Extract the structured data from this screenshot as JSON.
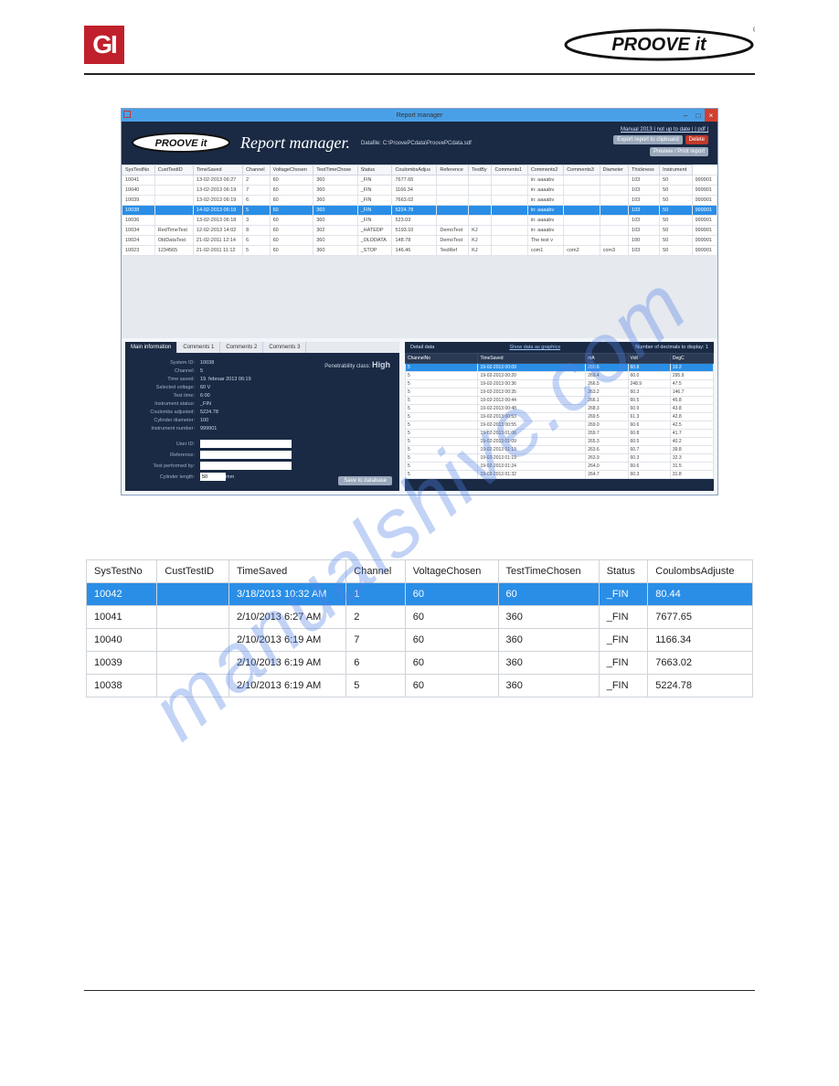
{
  "header": {
    "gi_logo_text": "GI",
    "proove_logo_text": "PROOVE it"
  },
  "watermark": "manualshive.com",
  "app": {
    "title_bar": "Report manager",
    "toolbar_title": "Report manager.",
    "datafile_label": "Datafile:",
    "datafile_path": "C:\\ProovePCdata\\ProovePCdata.sdf",
    "top_link": "Manual 2013 | not up to date | | pdf |",
    "btn_export": "Export report to clipboard",
    "btn_delete": "Delete",
    "btn_preview": "Preview / Print report",
    "main_columns": [
      "SysTestNo",
      "CustTestID",
      "TimeSaved",
      "Channel",
      "VoltageChosen",
      "TestTimeChose",
      "Status",
      "CoulombsAdjus",
      "Reference",
      "TestBy",
      "Comments1",
      "Comments2",
      "Comments3",
      "Diameter",
      "Thickness",
      "Instrument"
    ],
    "main_rows": [
      {
        "cells": [
          "10041",
          "",
          "13-02-2013 06:27",
          "2",
          "60",
          "360",
          "_FIN",
          "7677.65",
          "",
          "",
          "",
          "in: aaaabv",
          "",
          "",
          "103",
          "50",
          "999901"
        ],
        "sel": false
      },
      {
        "cells": [
          "10040",
          "",
          "13-02-2013 06:19",
          "7",
          "60",
          "360",
          "_FIN",
          "1166.34",
          "",
          "",
          "",
          "in: aaaabv",
          "",
          "",
          "103",
          "50",
          "999901"
        ],
        "sel": false
      },
      {
        "cells": [
          "10039",
          "",
          "13-02-2013 06:19",
          "6",
          "60",
          "360",
          "_FIN",
          "7663.02",
          "",
          "",
          "",
          "in: aaaabv",
          "",
          "",
          "103",
          "50",
          "999901"
        ],
        "sel": false
      },
      {
        "cells": [
          "10038",
          "",
          "14-02-2013 06:19",
          "5",
          "60",
          "360",
          "_FIN",
          "5224.78",
          "",
          "",
          "",
          "in: aaaabv",
          "",
          "",
          "103",
          "50",
          "999901"
        ],
        "sel": true
      },
      {
        "cells": [
          "10036",
          "",
          "13-02-2013 06:18",
          "3",
          "60",
          "360",
          "_FIN",
          "523.03",
          "",
          "",
          "",
          "in: aaaabv",
          "",
          "",
          "103",
          "50",
          "999901"
        ],
        "sel": false
      },
      {
        "cells": [
          "10034",
          "RedTimeTest",
          "12-02-2013 14:02",
          "8",
          "60",
          "302",
          "_HATEDP",
          "5193.10",
          "DemoTest",
          "KJ",
          "",
          "in: aaaabv",
          "",
          "",
          "103",
          "50",
          "999901"
        ],
        "sel": false
      },
      {
        "cells": [
          "10024",
          "OldDataTest",
          "21-02-2011 12:14",
          "6",
          "60",
          "360",
          "_OLDDATA",
          "148.78",
          "DemoTest",
          "KJ",
          "",
          "The test v",
          "",
          "",
          "100",
          "50",
          "999901"
        ],
        "sel": false
      },
      {
        "cells": [
          "10023",
          "1234565",
          "21-02-2011 11:12",
          "5",
          "60",
          "360",
          "_STOP",
          "146.46",
          "TestRef",
          "KJ",
          "",
          "com1",
          "com2",
          "com3",
          "103",
          "50",
          "999901"
        ],
        "sel": false
      }
    ],
    "tabs": [
      "Main information",
      "Comments 1",
      "Comments 2",
      "Comments 3"
    ],
    "form": {
      "system_id_label": "System ID:",
      "system_id": "10038",
      "channel_label": "Channel:",
      "channel": "5",
      "time_saved_label": "Time saved:",
      "time_saved": "19. februar 2013 06:19",
      "selected_voltage_label": "Selected voltage:",
      "selected_voltage": "60 V",
      "test_time_label": "Test time:",
      "test_time": "6:00",
      "instrument_status_label": "Instrument status:",
      "instrument_status": "_FIN",
      "coulombs_adjusted_label": "Coulombs adjusted:",
      "coulombs_adjusted": "5224.78",
      "cylinder_diameter_label": "Cylinder diameter:",
      "cylinder_diameter": "100",
      "instrument_number_label": "Instrument number:",
      "instrument_number": "999901",
      "user_id_label": "User ID:",
      "user_id": "",
      "reference_label": "Reference:",
      "reference": "",
      "test_performed_by_label": "Test performed by:",
      "test_performed_by": "",
      "cylinder_length_label": "Cylinder length:",
      "cylinder_length": "50",
      "cylinder_length_unit": "mm"
    },
    "pen_label": "Penetrability class:",
    "pen_value": "High",
    "save_btn": "Save to database",
    "detail_head_left": "Detail data",
    "detail_head_link": "Show data as graphics",
    "detail_head_right": "Number of decimals to display:",
    "detail_decimals": "1",
    "detail_columns": [
      "ChannelNo",
      "TimeSaved",
      "mA",
      "Volt",
      "DegC"
    ],
    "detail_rows": [
      {
        "cells": [
          "5",
          "19-02-2013 00:09",
          "280.6",
          "60.8",
          "19.2"
        ],
        "sel": true
      },
      {
        "cells": [
          "5",
          "19-02-2013 00:20",
          "269.4",
          "60.0",
          "295.9"
        ],
        "sel": false
      },
      {
        "cells": [
          "5",
          "19-02-2013 00:36",
          "266.5",
          "248.9",
          "47.5"
        ],
        "sel": false
      },
      {
        "cells": [
          "5",
          "19-02-2013 00:35",
          "263.2",
          "60.3",
          "146.7"
        ],
        "sel": false
      },
      {
        "cells": [
          "5",
          "19-02-2013 00:44",
          "266.1",
          "60.5",
          "45.8"
        ],
        "sel": false
      },
      {
        "cells": [
          "5",
          "19-02-2013 00:48",
          "268.3",
          "60.9",
          "43.8"
        ],
        "sel": false
      },
      {
        "cells": [
          "5",
          "19-02-2013 00:53",
          "269.5",
          "61.3",
          "42.8"
        ],
        "sel": false
      },
      {
        "cells": [
          "5",
          "19-02-2013 00:55",
          "269.0",
          "60.6",
          "42.5"
        ],
        "sel": false
      },
      {
        "cells": [
          "5",
          "19-02-2013 01:06",
          "269.7",
          "60.8",
          "41.7"
        ],
        "sel": false
      },
      {
        "cells": [
          "5",
          "19-02-2013 01:09",
          "265.3",
          "60.5",
          "40.2"
        ],
        "sel": false
      },
      {
        "cells": [
          "5",
          "19-02-2013 01:13",
          "263.6",
          "60.7",
          "39.8"
        ],
        "sel": false
      },
      {
        "cells": [
          "5",
          "19-02-2013 01:19",
          "263.9",
          "60.3",
          "32.3"
        ],
        "sel": false
      },
      {
        "cells": [
          "5",
          "19-02-2013 01:24",
          "264.0",
          "60.6",
          "31.5"
        ],
        "sel": false
      },
      {
        "cells": [
          "5",
          "19-02-2013 01:32",
          "264.7",
          "60.3",
          "31.8"
        ],
        "sel": false
      }
    ]
  },
  "zoom": {
    "columns": [
      "SysTestNo",
      "CustTestID",
      "TimeSaved",
      "Channel",
      "VoltageChosen",
      "TestTimeChosen",
      "Status",
      "CoulombsAdjuste"
    ],
    "rows": [
      {
        "cells": [
          "10042",
          "",
          "3/18/2013 10:32 AM",
          "1",
          "60",
          "60",
          "_FIN",
          "80.44"
        ],
        "sel": true
      },
      {
        "cells": [
          "10041",
          "",
          "2/10/2013 6:27 AM",
          "2",
          "60",
          "360",
          "_FIN",
          "7677.65"
        ],
        "sel": false
      },
      {
        "cells": [
          "10040",
          "",
          "2/10/2013 6:19 AM",
          "7",
          "60",
          "360",
          "_FIN",
          "1166.34"
        ],
        "sel": false
      },
      {
        "cells": [
          "10039",
          "",
          "2/10/2013 6:19 AM",
          "6",
          "60",
          "360",
          "_FIN",
          "7663.02"
        ],
        "sel": false
      },
      {
        "cells": [
          "10038",
          "",
          "2/10/2013 6:19 AM",
          "5",
          "60",
          "360",
          "_FIN",
          "5224.78"
        ],
        "sel": false
      }
    ]
  }
}
